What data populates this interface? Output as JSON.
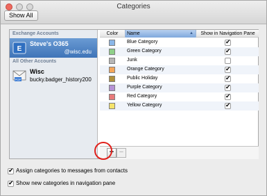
{
  "window": {
    "title": "Categories",
    "show_all_label": "Show All"
  },
  "sidebar": {
    "exchange_heading": "Exchange Accounts",
    "exchange_account": {
      "name": "Steve's O365",
      "email": "@wisc.edu",
      "icon": "exchange-icon"
    },
    "other_heading": "All Other Accounts",
    "other_account": {
      "name": "Wisc",
      "email": "bucky.badger_history200",
      "icon": "pop-mail-icon"
    }
  },
  "table": {
    "columns": {
      "color": "Color",
      "name": "Name",
      "show": "Show in Navigation Pane"
    },
    "rows": [
      {
        "name": "Blue Category",
        "color": "#8ab6e8",
        "show": true
      },
      {
        "name": "Green Category",
        "color": "#8fd08a",
        "show": true
      },
      {
        "name": "Junk",
        "color": "#b6b6b6",
        "show": false
      },
      {
        "name": "Orange Category",
        "color": "#f4a65a",
        "show": true
      },
      {
        "name": "Public Holiday",
        "color": "#b0903c",
        "show": true
      },
      {
        "name": "Purple Category",
        "color": "#b592d6",
        "show": true
      },
      {
        "name": "Red Category",
        "color": "#e87a7a",
        "show": true
      },
      {
        "name": "Yellow Category",
        "color": "#f5e36a",
        "show": true
      }
    ]
  },
  "controls": {
    "add": "+",
    "remove": "−"
  },
  "options": {
    "assign": "Assign categories to messages from contacts",
    "show_new": "Show new categories in navigation pane"
  }
}
